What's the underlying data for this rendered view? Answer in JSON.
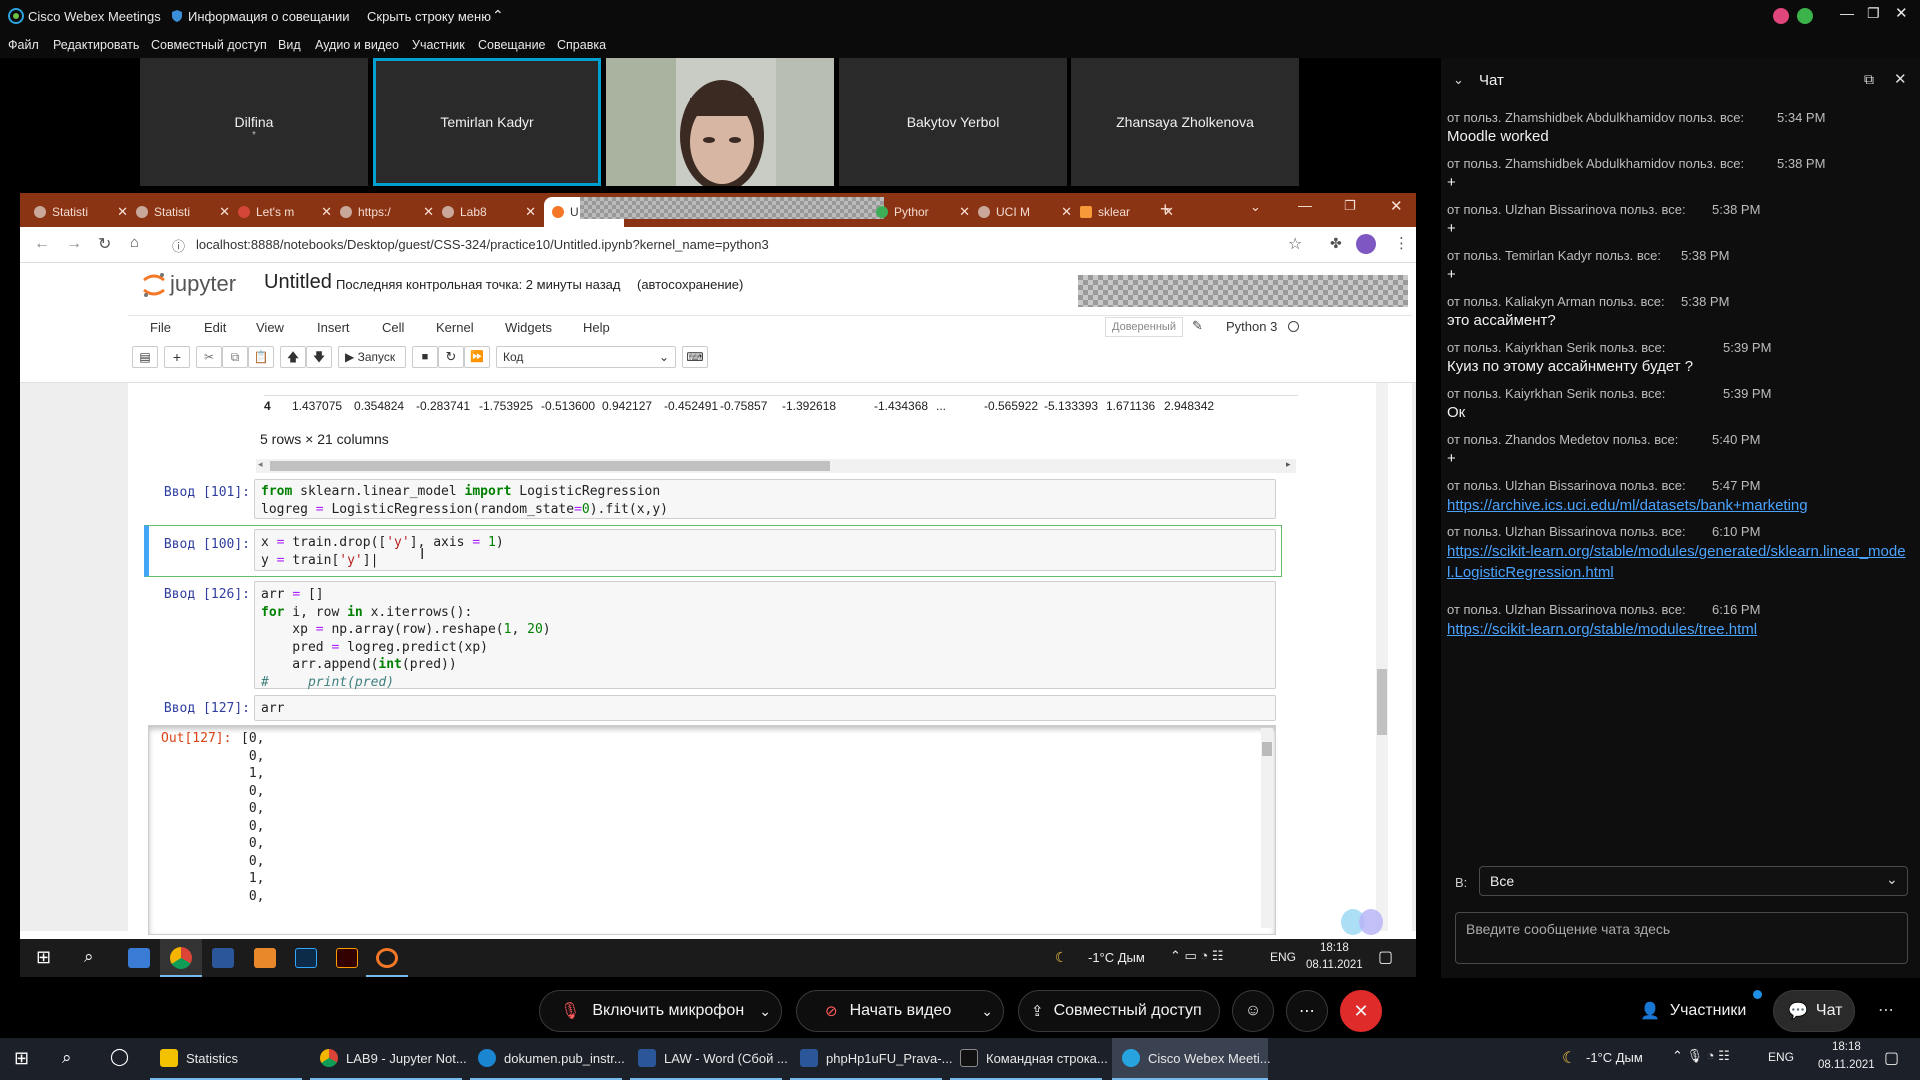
{
  "webex": {
    "app_title": "Cisco Webex Meetings",
    "meeting_info": "Информация о совещании",
    "hide_menu": "Скрыть строку меню",
    "menu": [
      "Файл",
      "Редактировать",
      "Совместный доступ",
      "Вид",
      "Аудио и видео",
      "Участник",
      "Совещание",
      "Справка"
    ]
  },
  "participants": [
    {
      "name": "Dilfina",
      "sub": "*"
    },
    {
      "name": "Temirlan Kadyr",
      "sub": ""
    },
    {
      "name": "",
      "sub": ""
    },
    {
      "name": "Bakytov Yerbol",
      "sub": ""
    },
    {
      "name": "Zhansaya Zholkenova",
      "sub": ""
    }
  ],
  "browser": {
    "tabs": [
      "Statisti",
      "Statisti",
      "Let's m",
      "https:/",
      "Lab8",
      "U",
      "Pythor",
      "UCI M",
      "sklear"
    ],
    "url": "localhost:8888/notebooks/Desktop/guest/CSS-324/practice10/Untitled.ipynb?kernel_name=python3"
  },
  "jupyter": {
    "logo": "jupyter",
    "notebook_name": "Untitled",
    "checkpoint": "Последняя контрольная точка: 2 минуты назад",
    "autosave": "(автосохранение)",
    "menu": [
      "File",
      "Edit",
      "View",
      "Insert",
      "Cell",
      "Kernel",
      "Widgets",
      "Help"
    ],
    "trusted": "Доверенный",
    "kernel": "Python 3",
    "run_label": "Запуск",
    "cell_type": "Код",
    "df_row": [
      "4",
      "1.437075",
      "0.354824",
      "-0.283741",
      "-1.753925",
      "-0.513600",
      "0.942127",
      "-0.452491",
      "-0.75857",
      "-1.392618",
      "-1.434368",
      "...",
      "-0.565922",
      "-5.133393",
      "1.671136",
      "2.948342"
    ],
    "df_shape": "5 rows × 21 columns",
    "cells": [
      {
        "prompt": "Ввод [101]:"
      },
      {
        "prompt": "Ввод [100]:"
      },
      {
        "prompt": "Ввод [126]:"
      },
      {
        "prompt": "Ввод [127]:",
        "code": "arr"
      }
    ],
    "out_prompt": "Out[127]:",
    "output_lines": [
      "[0,",
      "0,",
      "1,",
      "0,",
      "0,",
      "0,",
      "0,",
      "0,",
      "1,",
      "0,"
    ]
  },
  "taskbar_inner": {
    "weather": "-1°C  Дым",
    "lang": "ENG",
    "time": "18:18",
    "date": "08.11.2021"
  },
  "chat": {
    "title": "Чат",
    "messages": [
      {
        "from": "от польз. Zhamshidbek Abdulkhamidov польз. все:",
        "time": "5:34 PM",
        "text": "Moodle worked"
      },
      {
        "from": "от польз. Zhamshidbek Abdulkhamidov польз. все:",
        "time": "5:38 PM",
        "text": "+"
      },
      {
        "from": "от польз. Ulzhan Bissarinova польз. все:",
        "time": "5:38 PM",
        "text": "+"
      },
      {
        "from": "от польз. Temirlan Kadyr польз. все:",
        "time": "5:38 PM",
        "text": "+"
      },
      {
        "from": "от польз. Kaliakyn Arman польз. все:",
        "time": "5:38 PM",
        "text": "это ассаймент?"
      },
      {
        "from": "от польз. Kaiyrkhan Serik польз. все:",
        "time": "5:39 PM",
        "text": "Куиз по этому ассайнменту будет ?"
      },
      {
        "from": "от польз. Kaiyrkhan Serik польз. все:",
        "time": "5:39 PM",
        "text": "Ок"
      },
      {
        "from": "от польз. Zhandos Medetov польз. все:",
        "time": "5:40 PM",
        "text": "+"
      },
      {
        "from": "от польз. Ulzhan Bissarinova польз. все:",
        "time": "5:47 PM",
        "link": "https://archive.ics.uci.edu/ml/datasets/bank+marketing"
      },
      {
        "from": "от польз. Ulzhan Bissarinova польз. все:",
        "time": "6:10 PM",
        "link": "https://scikit-learn.org/stable/modules/generated/sklearn.linear_model.LogisticRegression.html"
      },
      {
        "from": "от польз. Ulzhan Bissarinova польз. все:",
        "time": "6:16 PM",
        "link": "https://scikit-learn.org/stable/modules/tree.html"
      }
    ],
    "to_label": "В:",
    "to_value": "Все",
    "input_placeholder": "Введите сообщение чата здесь"
  },
  "controls": {
    "mic": "Включить микрофон",
    "video": "Начать видео",
    "share": "Совместный доступ",
    "participants": "Участники",
    "chat": "Чат"
  },
  "taskbar": {
    "apps": [
      "Statistics",
      "LAB9 - Jupyter Not...",
      "dokumen.pub_instr...",
      "LAW - Word (Сбой ...",
      "phpHp1uFU_Prava-...",
      "Командная строка...",
      "Cisco Webex Meeti..."
    ],
    "weather": "-1°C  Дым",
    "lang": "ENG",
    "time": "18:18",
    "date": "08.11.2021"
  },
  "colors": {
    "accent": "#00a0d1",
    "chrome_tab": "#8a3414",
    "link": "#4aa3ff",
    "end_call": "#e02b2b"
  }
}
